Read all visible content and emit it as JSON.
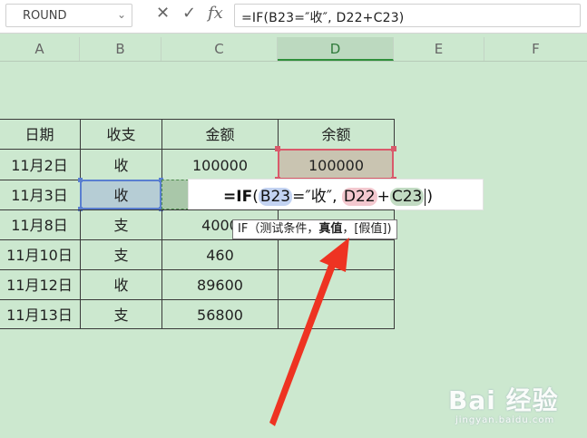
{
  "formula_bar": {
    "name_box": "ROUND",
    "name_box_caret": "⌄",
    "cancel_glyph": "✕",
    "enter_glyph": "✓",
    "fx_glyph": "fx",
    "formula": "=IF(B23=″收″, D22+C23)"
  },
  "columns": [
    "A",
    "B",
    "C",
    "D",
    "E",
    "F"
  ],
  "header_row": {
    "a": "日期",
    "b": "收支",
    "c": "金额",
    "d": "余额"
  },
  "rows": [
    {
      "a": "11月2日",
      "b": "收",
      "c": "100000",
      "d": "100000"
    },
    {
      "a": "11月3日",
      "b": "收",
      "c": "",
      "d": ""
    },
    {
      "a": "11月8日",
      "b": "支",
      "c": "4000",
      "d": ""
    },
    {
      "a": "11月10日",
      "b": "支",
      "c": "460",
      "d": ""
    },
    {
      "a": "11月12日",
      "b": "收",
      "c": "89600",
      "d": ""
    },
    {
      "a": "11月13日",
      "b": "支",
      "c": "56800",
      "d": ""
    }
  ],
  "editor": {
    "prefix": "=IF",
    "open_paren": "(",
    "ref_b": "B23",
    "middle": "=″收″,",
    "ref_d": "D22",
    "plus": "+",
    "ref_c": "C23",
    "close_paren": ")"
  },
  "tooltip": {
    "fn": "IF",
    "open": "（测试条件，",
    "bold": "真值",
    "rest": "，[假值])"
  },
  "annotation": {
    "arrow_color": "#ee3322"
  },
  "watermark": {
    "main": "Bai 经验",
    "sub": "jingyan.baidu.com"
  },
  "colors": {
    "sheet_bg": "#cce8cf",
    "d_selection_border": "#d95a6b",
    "b_selection_border": "#5a7fd0"
  }
}
